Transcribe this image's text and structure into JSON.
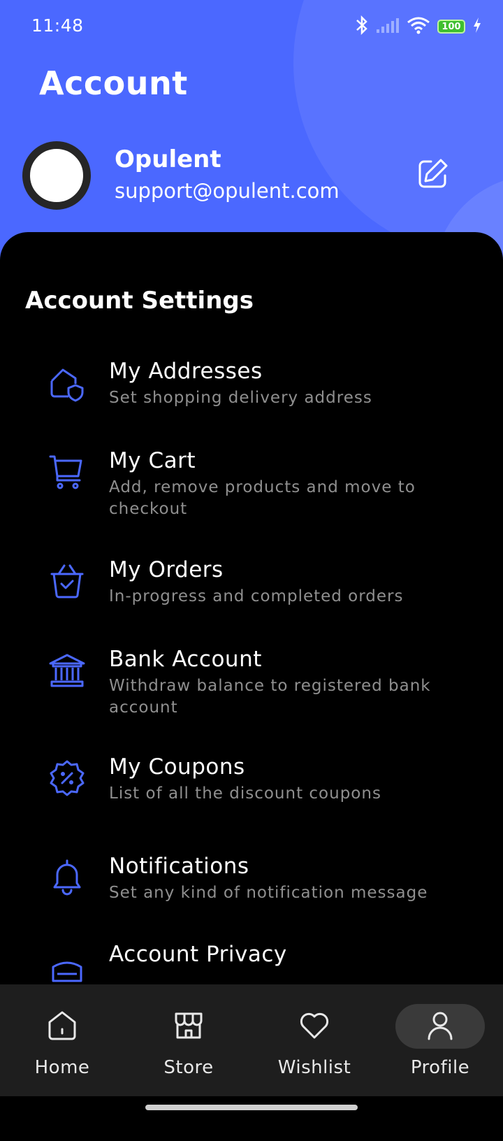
{
  "status_bar": {
    "time": "11:48",
    "battery": "100"
  },
  "header": {
    "title": "Account",
    "profile_name": "Opulent",
    "profile_email": "support@opulent.com"
  },
  "section_title": "Account Settings",
  "menu": [
    {
      "title": "My Addresses",
      "subtitle": "Set shopping delivery address",
      "icon": "home-shield-icon"
    },
    {
      "title": "My Cart",
      "subtitle": "Add, remove products and move to checkout",
      "icon": "cart-icon"
    },
    {
      "title": "My Orders",
      "subtitle": "In-progress and completed orders",
      "icon": "basket-check-icon"
    },
    {
      "title": "Bank Account",
      "subtitle": "Withdraw balance to registered bank account",
      "icon": "bank-icon"
    },
    {
      "title": "My Coupons",
      "subtitle": "List of all the discount coupons",
      "icon": "discount-badge-icon"
    },
    {
      "title": "Notifications",
      "subtitle": "Set any kind of notification message",
      "icon": "bell-icon"
    },
    {
      "title": "Account Privacy",
      "subtitle": "",
      "icon": "security-card-icon"
    }
  ],
  "bottom_nav": [
    {
      "label": "Home",
      "icon": "home-icon"
    },
    {
      "label": "Store",
      "icon": "store-icon"
    },
    {
      "label": "Wishlist",
      "icon": "heart-icon"
    },
    {
      "label": "Profile",
      "icon": "user-icon",
      "active": true
    }
  ],
  "colors": {
    "primary": "#4B68FF",
    "background": "#000000",
    "nav_background": "#1E1E1E"
  }
}
